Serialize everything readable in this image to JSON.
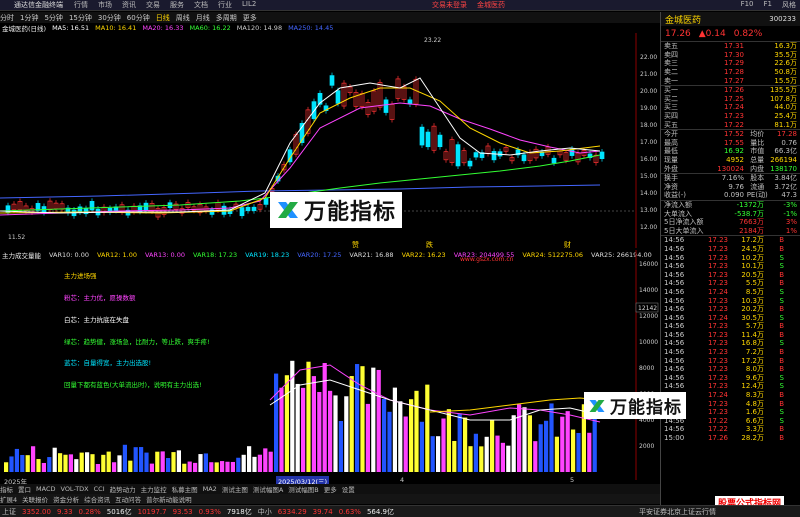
{
  "titlebar": {
    "app": "通达信金融终端",
    "menus": [
      "行情",
      "市场",
      "资讯",
      "交易",
      "服务",
      "文档",
      "行业",
      "LIL2"
    ],
    "center_tabs": [
      "交易未登录",
      "金城医药"
    ],
    "right_items": [
      "F10",
      "F1",
      "风格"
    ]
  },
  "periods": [
    "分时",
    "1分钟",
    "5分钟",
    "15分钟",
    "30分钟",
    "60分钟",
    "日线",
    "周线",
    "月线",
    "多周期",
    "更多"
  ],
  "active_period": "日线",
  "chart_info": {
    "name": "金城医药(日线)",
    "ma": [
      {
        "label": "MA5: 16.51",
        "color": "#ffffff"
      },
      {
        "label": "MA10: 16.41",
        "color": "#ffd700"
      },
      {
        "label": "MA20: 16.33",
        "color": "#ff44ff"
      },
      {
        "label": "MA60: 16.22",
        "color": "#33ff33"
      },
      {
        "label": "MA120: 14.98",
        "color": "#cccccc"
      },
      {
        "label": "MA250: 14.45",
        "color": "#4466ff"
      }
    ]
  },
  "main_axis": [
    "22.00",
    "21.00",
    "20.00",
    "19.00",
    "18.00",
    "17.00",
    "16.00",
    "15.00",
    "14.00",
    "13.00",
    "12.00"
  ],
  "high_label": "23.22",
  "low_label": "11.52",
  "marks": [
    "赞",
    "跌",
    "财"
  ],
  "sub_info": {
    "name": "主力成交量能",
    "vars": [
      {
        "label": "VAR10: 0.00",
        "color": "#dddddd"
      },
      {
        "label": "VAR12: 1.00",
        "color": "#ffd700"
      },
      {
        "label": "VAR13: 0.00",
        "color": "#ff44ff"
      },
      {
        "label": "VAR18: 17.23",
        "color": "#33ff33"
      },
      {
        "label": "VAR19: 18.23",
        "color": "#00e5ff"
      },
      {
        "label": "VAR20: 17.25",
        "color": "#4466ff"
      },
      {
        "label": "VAR21: 16.88",
        "color": "#dddddd"
      },
      {
        "label": "VAR22: 16.23",
        "color": "#ffd700"
      },
      {
        "label": "VAR23: 204499.55",
        "color": "#ff44ff"
      },
      {
        "label": "VAR24: 512275.06",
        "color": "#ffd700"
      },
      {
        "label": "VAR25: 266194.00",
        "color": "#dddddd"
      }
    ]
  },
  "legend": [
    {
      "text": "主力进场强",
      "color": "#ffd700"
    },
    {
      "text": "粉芯：主力优，愿操数额",
      "color": "#ff44ff"
    },
    {
      "text": "白芯：主力抗底在失盘",
      "color": "#ffffff"
    },
    {
      "text": "绿芯：趋势健，涨场急，比耐力，等止跌，爽手疼!",
      "color": "#33ff33"
    },
    {
      "text": "蓝芯：自量得宽，主力出选股!",
      "color": "#00e5ff"
    },
    {
      "text": "回量下都有蓝色(大单流出时)，说明有主力出选!",
      "color": "#33ff33"
    }
  ],
  "sub_axis": [
    "16000",
    "14000",
    "12000",
    "10000",
    "8000",
    "6000",
    "4000",
    "2000"
  ],
  "sub_marker": "12142",
  "dates": [
    "2025年",
    "2025/03/12(三)",
    "4",
    "5"
  ],
  "bottom_tabs": [
    "指标",
    "置口",
    "MACD",
    "VOL-TDX",
    "CCI",
    "趋势动力",
    "主力监控",
    "私募主图",
    "MA2",
    "测试主图",
    "测试幅图A",
    "测试幅图B",
    "更多",
    "设置"
  ],
  "bottom_tabs2": [
    "扩展4",
    "关联报价",
    "资金分析",
    "综合资讯",
    "互动问答",
    "普尔新动能说明"
  ],
  "status": {
    "sh_label": "上证",
    "sh_val": "3352.00",
    "sh_chg": "9.33",
    "sh_pct": "0.28%",
    "sh_amt": "5016亿",
    "sz_val": "10197.7",
    "sz_chg": "93.53",
    "sz_pct": "0.93%",
    "sz_amt": "7918亿",
    "zx_label": "中小",
    "zx_val": "6334.29",
    "zx_chg": "39.74",
    "zx_pct": "0.63%",
    "zx_amt": "564.9亿",
    "right": "平安证券北京上证云行情"
  },
  "sidebar": {
    "name": "金城医药",
    "code": "300233",
    "price": "17.26",
    "change": "▲0.14",
    "pct": "0.82%",
    "asks": [
      {
        "l": "卖五",
        "p": "17.31",
        "v": "16.3万"
      },
      {
        "l": "卖四",
        "p": "17.30",
        "v": "35.5万"
      },
      {
        "l": "卖三",
        "p": "17.29",
        "v": "22.6万"
      },
      {
        "l": "卖二",
        "p": "17.28",
        "v": "50.8万"
      },
      {
        "l": "卖一",
        "p": "17.27",
        "v": "15.5万"
      }
    ],
    "bids": [
      {
        "l": "买一",
        "p": "17.26",
        "v": "135.5万"
      },
      {
        "l": "买二",
        "p": "17.25",
        "v": "107.8万"
      },
      {
        "l": "买三",
        "p": "17.24",
        "v": "44.0万"
      },
      {
        "l": "买四",
        "p": "17.23",
        "v": "25.4万"
      },
      {
        "l": "买五",
        "p": "17.22",
        "v": "81.1万"
      }
    ],
    "stats": [
      {
        "a": "今开",
        "b": "17.52",
        "c": "均价",
        "d": "17.28"
      },
      {
        "a": "最高",
        "b": "17.55",
        "c": "量比",
        "d": "0.76"
      },
      {
        "a": "最低",
        "b": "16.92",
        "c": "市值",
        "d": "66.3亿"
      },
      {
        "a": "现量",
        "b": "4952",
        "c": "总量",
        "d": "266194"
      },
      {
        "a": "外盘",
        "b": "130024",
        "c": "内盘",
        "d": "138170"
      }
    ],
    "stats2": [
      {
        "a": "换手",
        "b": "7.16%",
        "c": "股本",
        "d": "3.84亿"
      },
      {
        "a": "净资",
        "b": "9.76",
        "c": "流通",
        "d": "3.72亿"
      },
      {
        "a": "收益(-)",
        "b": "0.090",
        "c": "PE(动)",
        "d": "47.3"
      }
    ],
    "flows": [
      {
        "a": "净流入额",
        "b": "-1372万",
        "c": "-3%"
      },
      {
        "a": "大单流入",
        "b": "-538.7万",
        "c": "-1%"
      },
      {
        "a": "5日净流入额",
        "b": "7663万",
        "c": "3%"
      },
      {
        "a": "5日大单流入",
        "b": "2184万",
        "c": "1%"
      }
    ],
    "ticks": [
      [
        "14:56",
        "17.23",
        "17.2万",
        "B"
      ],
      [
        "14:56",
        "17.23",
        "24.5万",
        "B"
      ],
      [
        "14:56",
        "17.23",
        "10.2万",
        "S"
      ],
      [
        "14:56",
        "17.23",
        "10.1万",
        "S"
      ],
      [
        "14:56",
        "17.23",
        "20.5万",
        "B"
      ],
      [
        "14:56",
        "17.23",
        "5.5万",
        "B"
      ],
      [
        "14:56",
        "17.24",
        "8.5万",
        "S"
      ],
      [
        "14:56",
        "17.23",
        "10.3万",
        "S"
      ],
      [
        "14:56",
        "17.23",
        "20.2万",
        "B"
      ],
      [
        "14:56",
        "17.24",
        "30.5万",
        "S"
      ],
      [
        "14:56",
        "17.23",
        "5.7万",
        "B"
      ],
      [
        "14:56",
        "17.23",
        "11.4万",
        "B"
      ],
      [
        "14:56",
        "17.23",
        "16.8万",
        "S"
      ],
      [
        "14:56",
        "17.23",
        "7.2万",
        "B"
      ],
      [
        "14:56",
        "17.23",
        "17.2万",
        "B"
      ],
      [
        "14:56",
        "17.23",
        "8.0万",
        "B"
      ],
      [
        "14:56",
        "17.23",
        "9.6万",
        "S"
      ],
      [
        "14:56",
        "17.23",
        "12.4万",
        "S"
      ],
      [
        "14:56",
        "17.24",
        "8.3万",
        "B"
      ],
      [
        "14:56",
        "17.23",
        "4.8万",
        "B"
      ],
      [
        "14:56",
        "17.23",
        "1.6万",
        "S"
      ],
      [
        "14:56",
        "17.22",
        "6.6万",
        "S"
      ],
      [
        "14:56",
        "17.22",
        "3.3万",
        "B"
      ],
      [
        "15:00",
        "17.26",
        "28.2万",
        "B"
      ]
    ]
  },
  "watermark": "万能指标",
  "watermark_brand": "股票公式指标网",
  "watermark_url": "www.gszx.com.cn"
}
